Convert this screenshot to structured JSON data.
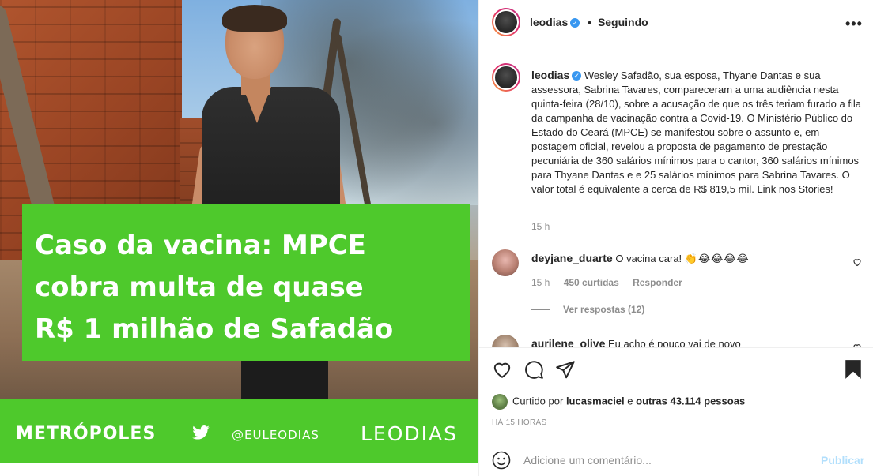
{
  "post": {
    "headline": "Caso da vacina: MPCE\ncobra multa de quase\nR$ 1 milhão de Safadão",
    "brand_left": "METRÓPOLES",
    "handle": "@EULEODIAS",
    "brand_right": "LEODIAS"
  },
  "header": {
    "username": "leodias",
    "verified_mark": "✓",
    "separator": "•",
    "follow_status": "Seguindo",
    "more": "•••"
  },
  "caption": {
    "username": "leodias",
    "text": "Wesley Safadão, sua esposa, Thyane Dantas e sua assessora, Sabrina Tavares, compareceram a uma audiência nesta quinta-feira (28/10), sobre a acusação de que os três teriam furado a fila da campanha de vacinação contra a Covid-19. O Ministério Público do Estado do Ceará (MPCE) se manifestou sobre o assunto e, em postagem oficial, revelou a proposta de pagamento de prestação pecuniária de 360 salários mínimos para o cantor, 360 salários mínimos para Thyane Dantas e e 25 salários mínimos para Sabrina Tavares. O valor total é equivalente a cerca de R$ 819,5 mil. Link nos Stories!",
    "time": "15 h"
  },
  "comments": [
    {
      "username": "deyjane_duarte",
      "text": "O vacina cara!",
      "emojis": "👏😂😂😂😂",
      "time": "15 h",
      "likes": "450 curtidas",
      "reply": "Responder",
      "view_replies": "Ver respostas (12)"
    },
    {
      "username": "aurilene_olive",
      "text": "Eu acho é pouco vai de novo"
    }
  ],
  "likes": {
    "prefix": "Curtido por",
    "user": "lucasmaciel",
    "conj": "e",
    "others": "outras 43.114 pessoas"
  },
  "posted_ago": "HÁ 15 HORAS",
  "add_comment": {
    "placeholder": "Adicione um comentário...",
    "publish": "Publicar"
  },
  "icons": {
    "twitter": "twitter-icon",
    "like": "heart-icon",
    "comment": "comment-icon",
    "share": "share-icon",
    "save": "bookmark-icon",
    "emoji": "emoji-icon"
  },
  "colors": {
    "brand_green": "#4ec92c",
    "verified_blue": "#3897f0",
    "publish_disabled": "#b2dffc"
  }
}
